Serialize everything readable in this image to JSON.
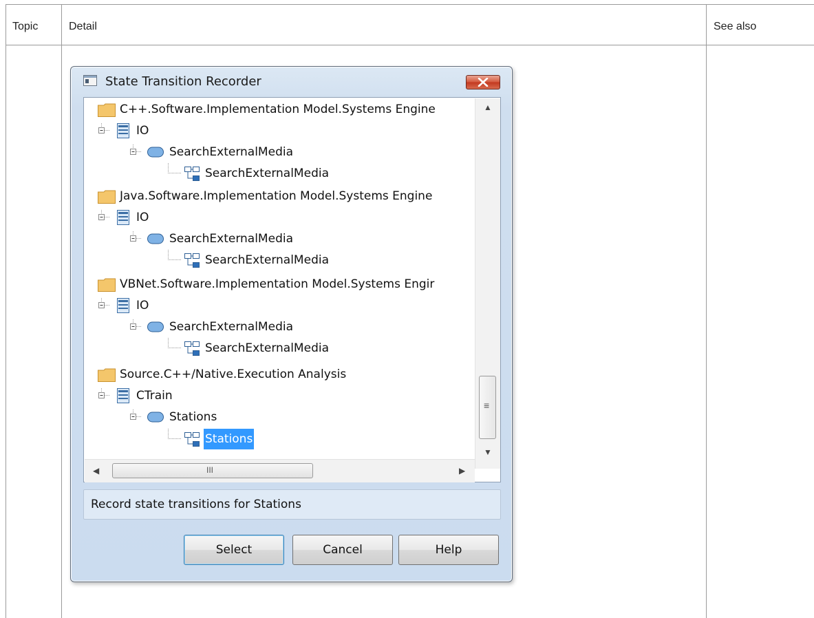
{
  "table": {
    "headers": [
      "Topic",
      "Detail",
      "See also"
    ]
  },
  "dialog": {
    "title": "State Transition Recorder",
    "app_icon": "window-icon",
    "close_icon": "close-icon",
    "tree": {
      "groups": [
        {
          "package": "C++.Software.Implementation Model.Systems Engine",
          "class": "IO",
          "operation": "SearchExternalMedia",
          "diagram": "SearchExternalMedia"
        },
        {
          "package": "Java.Software.Implementation Model.Systems Engine",
          "class": "IO",
          "operation": "SearchExternalMedia",
          "diagram": "SearchExternalMedia"
        },
        {
          "package": "VBNet.Software.Implementation Model.Systems Engir",
          "class": "IO",
          "operation": "SearchExternalMedia",
          "diagram": "SearchExternalMedia"
        },
        {
          "package": "Source.C++/Native.Execution Analysis",
          "class": "CTrain",
          "operation": "Stations",
          "diagram": "Stations"
        }
      ],
      "selected_item": "Stations",
      "hscroll_thumb_glyph": "III",
      "vscroll_thumb_glyph": "≡"
    },
    "status_text": "Record state transitions for Stations",
    "buttons": {
      "select": "Select",
      "cancel": "Cancel",
      "help": "Help"
    },
    "colors": {
      "selection": "#3399ff",
      "folder": "#f4c66b",
      "close_button": "#c8452b"
    }
  }
}
